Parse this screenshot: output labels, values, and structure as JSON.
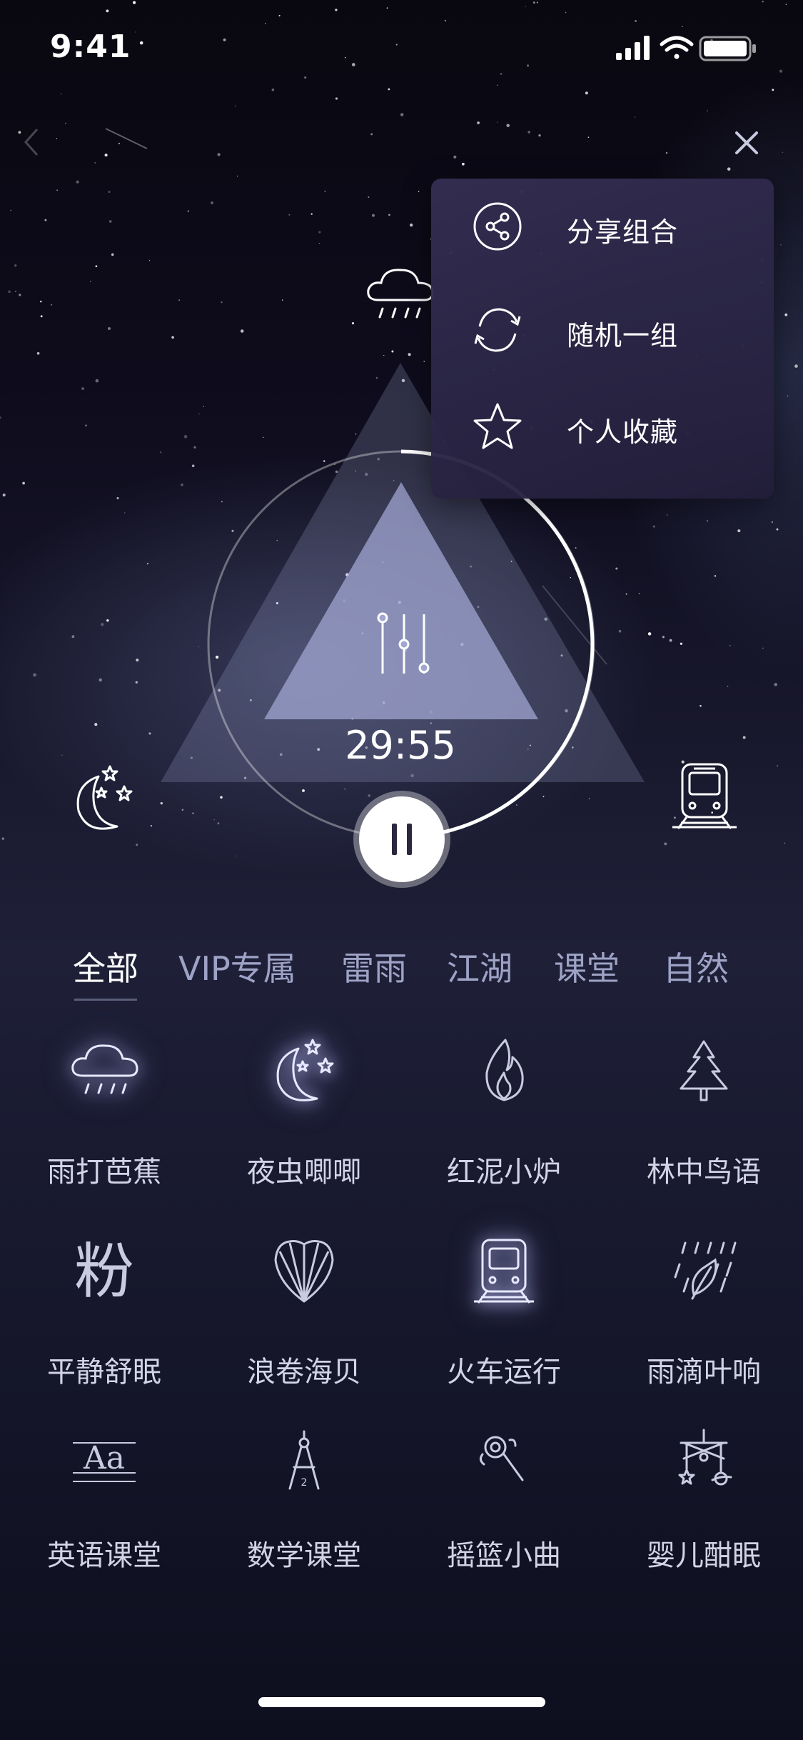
{
  "status_bar": {
    "time": "9:41"
  },
  "menu": {
    "items": [
      {
        "label": "分享组合",
        "icon": "share-icon"
      },
      {
        "label": "随机一组",
        "icon": "shuffle-icon"
      },
      {
        "label": "个人收藏",
        "icon": "star-icon"
      }
    ]
  },
  "player": {
    "timer": "29:55",
    "top_icon": "rain-cloud-icon",
    "left_icon": "moon-stars-icon",
    "right_icon": "train-icon",
    "center_icon": "equalizer-icon"
  },
  "tabs": [
    {
      "label": "全部",
      "active": true
    },
    {
      "label": "VIP专属",
      "active": false
    },
    {
      "label": "雷雨",
      "active": false
    },
    {
      "label": "江湖",
      "active": false
    },
    {
      "label": "课堂",
      "active": false
    },
    {
      "label": "自然",
      "active": false
    }
  ],
  "sounds": [
    {
      "label": "雨打芭蕉",
      "icon": "rain-cloud-icon",
      "selected": true
    },
    {
      "label": "夜虫唧唧",
      "icon": "moon-stars-icon",
      "selected": true
    },
    {
      "label": "红泥小炉",
      "icon": "flame-icon",
      "selected": false
    },
    {
      "label": "林中鸟语",
      "icon": "pine-tree-icon",
      "selected": false
    },
    {
      "label": "平静舒眠",
      "icon": "pink-noise-icon",
      "icon_text": "粉",
      "selected": false
    },
    {
      "label": "浪卷海贝",
      "icon": "seashell-icon",
      "selected": false
    },
    {
      "label": "火车运行",
      "icon": "train-icon",
      "selected": true
    },
    {
      "label": "雨滴叶响",
      "icon": "rain-leaf-icon",
      "selected": false
    },
    {
      "label": "英语课堂",
      "icon": "english-aa-icon",
      "icon_text": "Aa",
      "selected": false
    },
    {
      "label": "数学课堂",
      "icon": "compass-icon",
      "selected": false
    },
    {
      "label": "摇篮小曲",
      "icon": "rattle-icon",
      "selected": false
    },
    {
      "label": "婴儿酣眠",
      "icon": "baby-mobile-icon",
      "selected": false
    }
  ],
  "colors": {
    "accent": "#ffffff",
    "tab_inactive": "#9ea3c6",
    "menu_bg": "#2e2a4c"
  }
}
